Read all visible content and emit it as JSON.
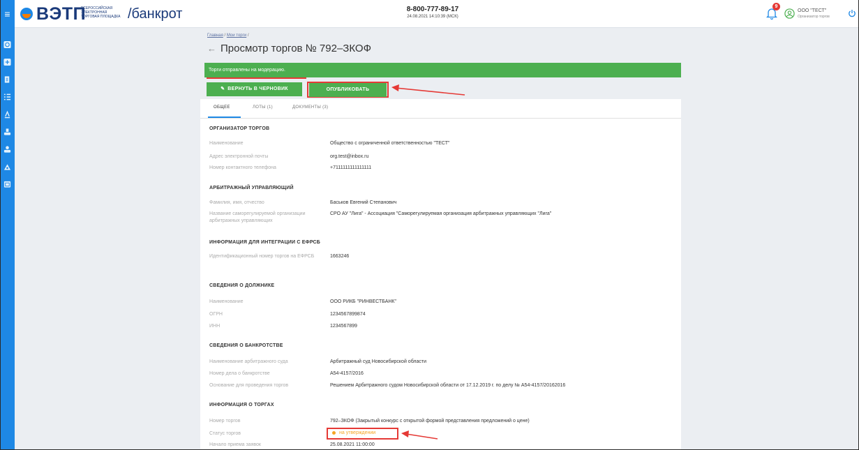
{
  "header": {
    "logo_text": "ВЭТП",
    "logo_sub": [
      "ВСЕРОССИЙСКАЯ",
      "ЭЛЕКТРОННАЯ",
      "ТОРГОВАЯ ПЛОЩАДКА"
    ],
    "section": "/банкрот",
    "phone": "8-800-777-89-17",
    "datetime": "24.08.2021 14:10:39 (МСК)",
    "notifications_count": "9",
    "org_name": "ООО \"ТЕСТ\"",
    "org_role": "Организатор торгов"
  },
  "breadcrumb": {
    "home": "Главная",
    "sep": "/",
    "my_trades": "Мои торги"
  },
  "page": {
    "back_arrow": "←",
    "title": "Просмотр торгов № 792–ЗКОФ"
  },
  "alert": {
    "text": "Торги отправлены на модерацию."
  },
  "buttons": {
    "return_draft": "ВЕРНУТЬ В ЧЕРНОВИК",
    "publish": "ОПУБЛИКОВАТЬ"
  },
  "tabs": [
    {
      "label": "ОБЩЕЕ"
    },
    {
      "label": "ЛОТЫ (1)"
    },
    {
      "label": "ДОКУМЕНТЫ (3)"
    }
  ],
  "sections": {
    "organizer": {
      "title": "ОРГАНИЗАТОР ТОРГОВ",
      "rows": [
        {
          "label": "Наименование",
          "value": "Общество с ограниченной ответственностью \"ТЕСТ\""
        },
        {
          "label": "Адрес электронной почты",
          "value": "org.test@inbox.ru"
        },
        {
          "label": "Номер контактного телефона",
          "value": "+7111111111111111"
        }
      ]
    },
    "manager": {
      "title": "АРБИТРАЖНЫЙ УПРАВЛЯЮЩИЙ",
      "rows": [
        {
          "label": "Фамилия, имя, отчество",
          "value": "Баськов Евгений Степанович"
        },
        {
          "label": "Название саморегулируемой организации арбитражных управляющих",
          "value": "СРО АУ \"Лига\" - Ассоциация \"Саморегулируемая организация арбитражных управляющих \"Лига\""
        }
      ]
    },
    "efrsb": {
      "title": "ИНФОРМАЦИЯ ДЛЯ ИНТЕГРАЦИИ С ЕФРСБ",
      "rows": [
        {
          "label": "Идентификационный номер торгов на ЕФРСБ",
          "value": "1663246"
        }
      ]
    },
    "debtor": {
      "title": "СВЕДЕНИЯ О ДОЛЖНИКЕ",
      "rows": [
        {
          "label": "Наименование",
          "value": "ООО РИКБ \"РИНВЕСТБАНК\""
        },
        {
          "label": "ОГРН",
          "value": "1234567899874"
        },
        {
          "label": "ИНН",
          "value": "1234567899"
        }
      ]
    },
    "bankruptcy": {
      "title": "СВЕДЕНИЯ О БАНКРОТСТВЕ",
      "rows": [
        {
          "label": "Наименование арбитражного суда",
          "value": "Арбитражный суд Новосибирской области"
        },
        {
          "label": "Номер дела о банкротстве",
          "value": "А54-4157/2016"
        },
        {
          "label": "Основание для проведения торгов",
          "value": "Решением Арбитражного судом Новосибирской области от 17.12.2019 г. по делу № А54-4157/20162016"
        }
      ]
    },
    "trade_info": {
      "title": "ИНФОРМАЦИЯ О ТОРГАХ",
      "rows": [
        {
          "label": "Номер торгов",
          "value": "792–ЗКОФ (Закрытый конкурс с открытой формой представления предложений о цене)"
        },
        {
          "label": "Статус торгов",
          "value": "на утверждении"
        },
        {
          "label": "Начало приема заявок",
          "value": "25.08.2021 11:00:00"
        }
      ]
    }
  },
  "colors": {
    "accent_blue": "#1e88e5",
    "success_green": "#4caf50",
    "highlight_red": "#e53935",
    "status_orange": "#f5a623"
  }
}
